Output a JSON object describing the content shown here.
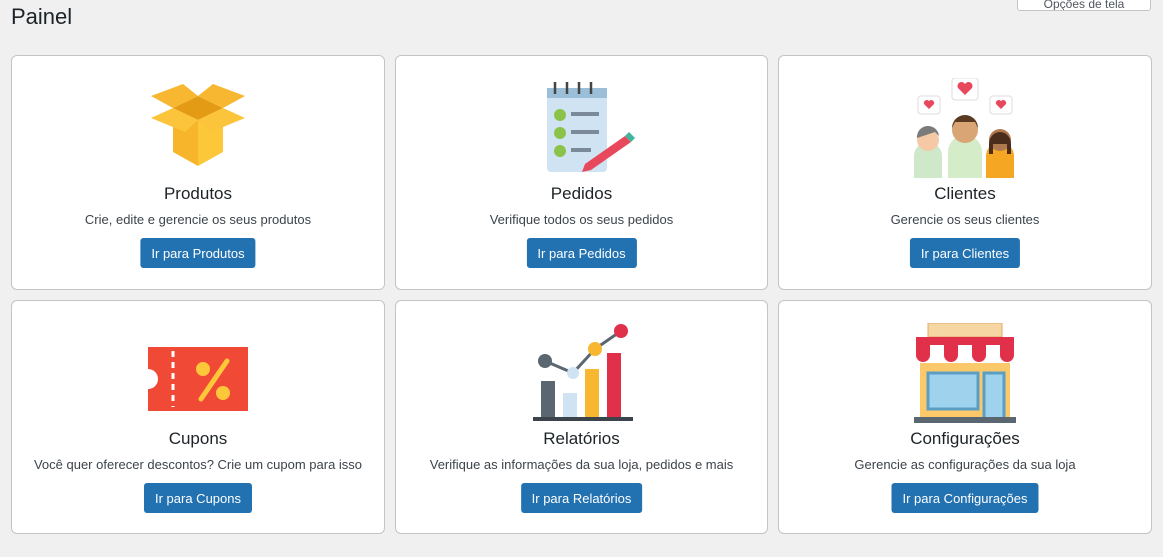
{
  "header": {
    "title": "Painel",
    "screen_options_label": "Opções de tela"
  },
  "cards": [
    {
      "title": "Produtos",
      "description": "Crie, edite e gerencie os seus produtos",
      "button": "Ir para Produtos",
      "icon": "box-icon"
    },
    {
      "title": "Pedidos",
      "description": "Verifique todos os seus pedidos",
      "button": "Ir para Pedidos",
      "icon": "checklist-notepad-icon"
    },
    {
      "title": "Clientes",
      "description": "Gerencie os seus clientes",
      "button": "Ir para Clientes",
      "icon": "customers-hearts-icon"
    },
    {
      "title": "Cupons",
      "description": "Você quer oferecer descontos? Crie um cupom para isso",
      "button": "Ir para Cupons",
      "icon": "coupon-percent-icon"
    },
    {
      "title": "Relatórios",
      "description": "Verifique as informações da sua loja, pedidos e mais",
      "button": "Ir para Relatórios",
      "icon": "bar-chart-icon"
    },
    {
      "title": "Configurações",
      "description": "Gerencie as configurações da sua loja",
      "button": "Ir para Configurações",
      "icon": "storefront-icon"
    }
  ],
  "colors": {
    "primary_button": "#2271b1",
    "background": "#f0f0f1",
    "card_border": "#c3c4c7"
  }
}
